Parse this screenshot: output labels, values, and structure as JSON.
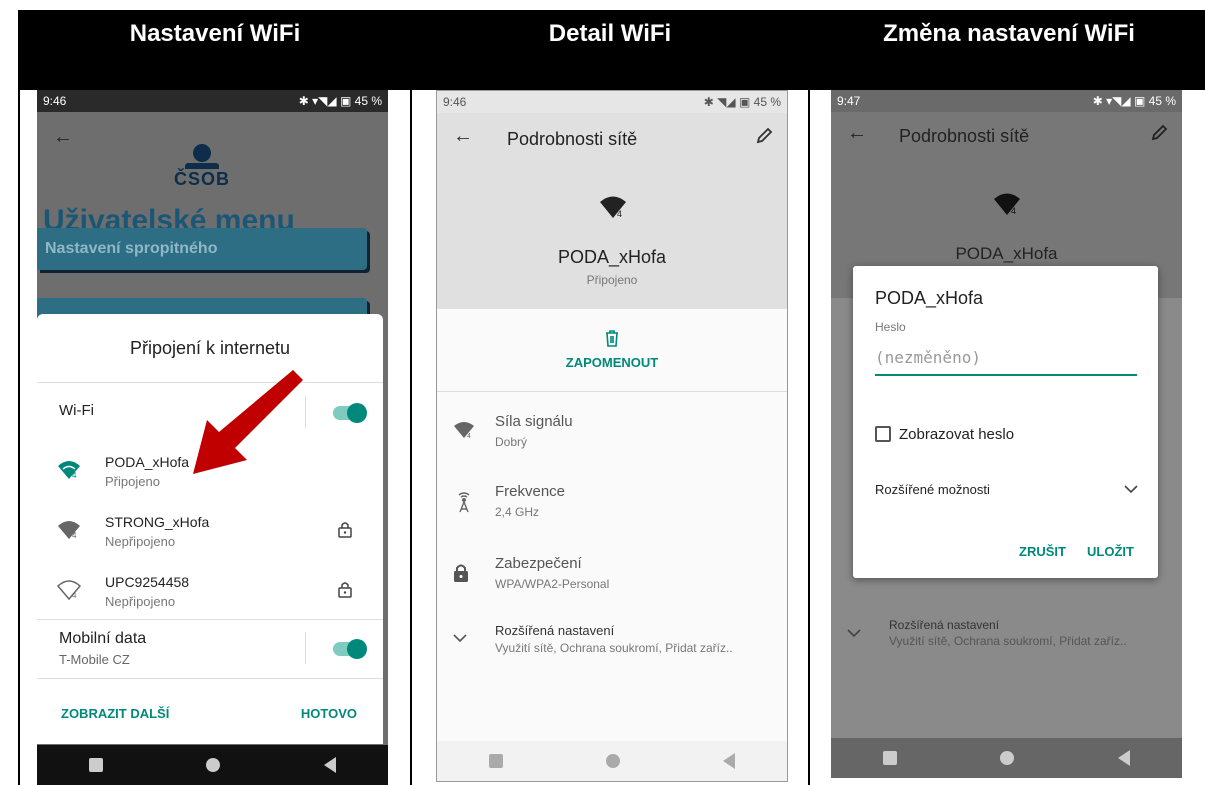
{
  "columns": {
    "col1": "Nastavení WiFi",
    "col2": "Detail WiFi",
    "col3": "Změna nastavení WiFi"
  },
  "phone1": {
    "status": {
      "time": "9:46",
      "icons": "✱ ▾◥◢ ▣ 45 %"
    },
    "logo": "ČSOB",
    "menu_title": "Uživatelské menu",
    "menu_items": [
      "Nastavení spropitného"
    ],
    "sheet": {
      "title": "Připojení k internetu",
      "wifi_label": "Wi-Fi",
      "networks": [
        {
          "name": "PODA_xHofa",
          "status": "Připojeno",
          "locked": false,
          "icon": "wifi-connected-icon"
        },
        {
          "name": "STRONG_xHofa",
          "status": "Nepřipojeno",
          "locked": true,
          "icon": "wifi-icon"
        },
        {
          "name": "UPC9254458",
          "status": "Nepřipojeno",
          "locked": true,
          "icon": "wifi-outline-icon"
        }
      ],
      "mobile_label": "Mobilní data",
      "mobile_carrier": "T-Mobile CZ",
      "show_more": "ZOBRAZIT DALŠÍ",
      "done": "HOTOVO"
    }
  },
  "phone2": {
    "status": {
      "time": "9:46",
      "icons": "✱ ◥◢ ▣ 45 %"
    },
    "title": "Podrobnosti sítě",
    "network_name": "PODA_xHofa",
    "network_status": "Připojeno",
    "forget": "ZAPOMENOUT",
    "details": [
      {
        "label": "Síla signálu",
        "value": "Dobrý",
        "icon": "signal-icon"
      },
      {
        "label": "Frekvence",
        "value": "2,4 GHz",
        "icon": "antenna-icon"
      },
      {
        "label": "Zabezpečení",
        "value": "WPA/WPA2-Personal",
        "icon": "lock-icon"
      }
    ],
    "advanced_label": "Rozšířená nastavení",
    "advanced_value": "Využití sítě, Ochrana soukromí, Přidat zaříz.."
  },
  "phone3": {
    "status": {
      "time": "9:47",
      "icons": "✱ ▾◥◢ ▣ 45 %"
    },
    "title": "Podrobnosti sítě",
    "network_name": "PODA_xHofa",
    "advanced_label": "Rozšířená nastavení",
    "advanced_value": "Využití sítě, Ochrana soukromí, Přidat zaříz..",
    "dialog": {
      "title": "PODA_xHofa",
      "password_label": "Heslo",
      "password_placeholder": "(nezměněno)",
      "show_password": "Zobrazovat heslo",
      "advanced_options": "Rozšířené možnosti",
      "cancel": "ZRUŠIT",
      "save": "ULOŽIT"
    }
  },
  "colors": {
    "accent": "#00897b",
    "arrow": "#c00000",
    "csob_blue": "#1a5776"
  }
}
